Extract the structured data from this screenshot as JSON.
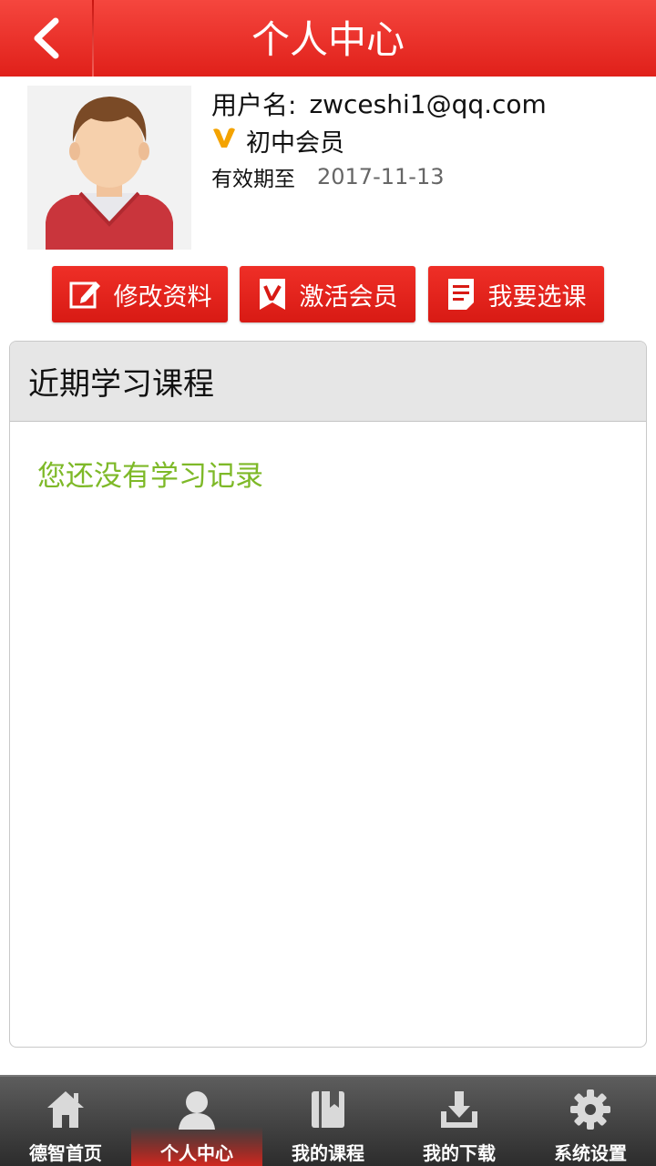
{
  "header": {
    "title": "个人中心",
    "back_icon": "back-arrow-icon"
  },
  "profile": {
    "username_label": "用户名:",
    "username": "zwceshi1@qq.com",
    "member_icon": "vip-v-icon",
    "member_level": "初中会员",
    "expiry_label": "有效期至",
    "expiry_date": "2017-11-13"
  },
  "actions": [
    {
      "label": "修改资料",
      "icon": "edit-icon"
    },
    {
      "label": "激活会员",
      "icon": "vip-badge-icon"
    },
    {
      "label": "我要选课",
      "icon": "document-icon"
    }
  ],
  "recent": {
    "title": "近期学习课程",
    "empty_text": "您还没有学习记录"
  },
  "tabbar": {
    "active_index": 1,
    "items": [
      {
        "label": "德智首页",
        "icon": "home-icon"
      },
      {
        "label": "个人中心",
        "icon": "user-icon"
      },
      {
        "label": "我的课程",
        "icon": "book-icon"
      },
      {
        "label": "我的下载",
        "icon": "download-icon"
      },
      {
        "label": "系统设置",
        "icon": "gear-icon"
      }
    ]
  },
  "colors": {
    "brand_red": "#e0201a",
    "empty_text_green": "#7eb928",
    "vip_gold": "#f4a300"
  }
}
